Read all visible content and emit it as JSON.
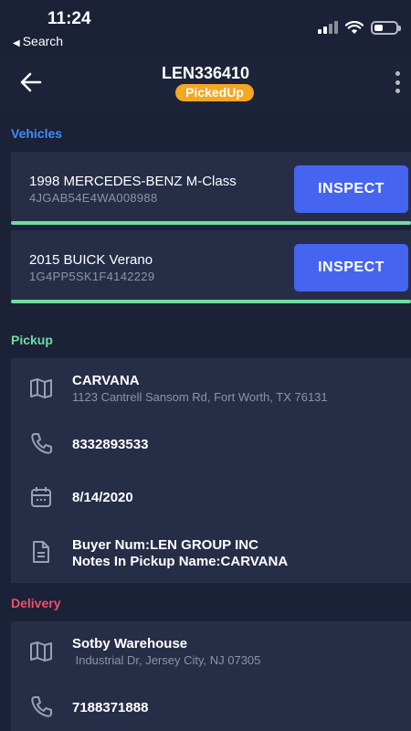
{
  "status_bar": {
    "time": "11:24",
    "back_app": "Search"
  },
  "header": {
    "title": "LEN336410",
    "status": "PickedUp"
  },
  "sections": {
    "vehicles": "Vehicles",
    "pickup": "Pickup",
    "delivery": "Delivery"
  },
  "colors": {
    "vehicles_title": "#3f8ef5",
    "pickup_title": "#6fdca0",
    "delivery_title": "#f0506e",
    "status_pill": "#f5a623",
    "inspect_button": "#4565f0"
  },
  "vehicles": [
    {
      "name": "1998 MERCEDES-BENZ M-Class",
      "vin": "4JGAB54E4WA008988",
      "button": "INSPECT",
      "progress": 1.0
    },
    {
      "name": "2015 BUICK Verano",
      "vin": "1G4PP5SK1F4142229",
      "button": "INSPECT",
      "progress": 1.0
    }
  ],
  "pickup": {
    "name": "CARVANA",
    "address": "1123 Cantrell Sansom Rd, Fort Worth, TX 76131",
    "phone": "8332893533",
    "date": "8/14/2020",
    "notes_line1": "Buyer Num:LEN GROUP INC",
    "notes_line2": "Notes In Pickup Name:CARVANA"
  },
  "delivery": {
    "name": "Sotby Warehouse",
    "address": " Industrial Dr, Jersey City, NJ 07305",
    "phone": "7188371888"
  }
}
